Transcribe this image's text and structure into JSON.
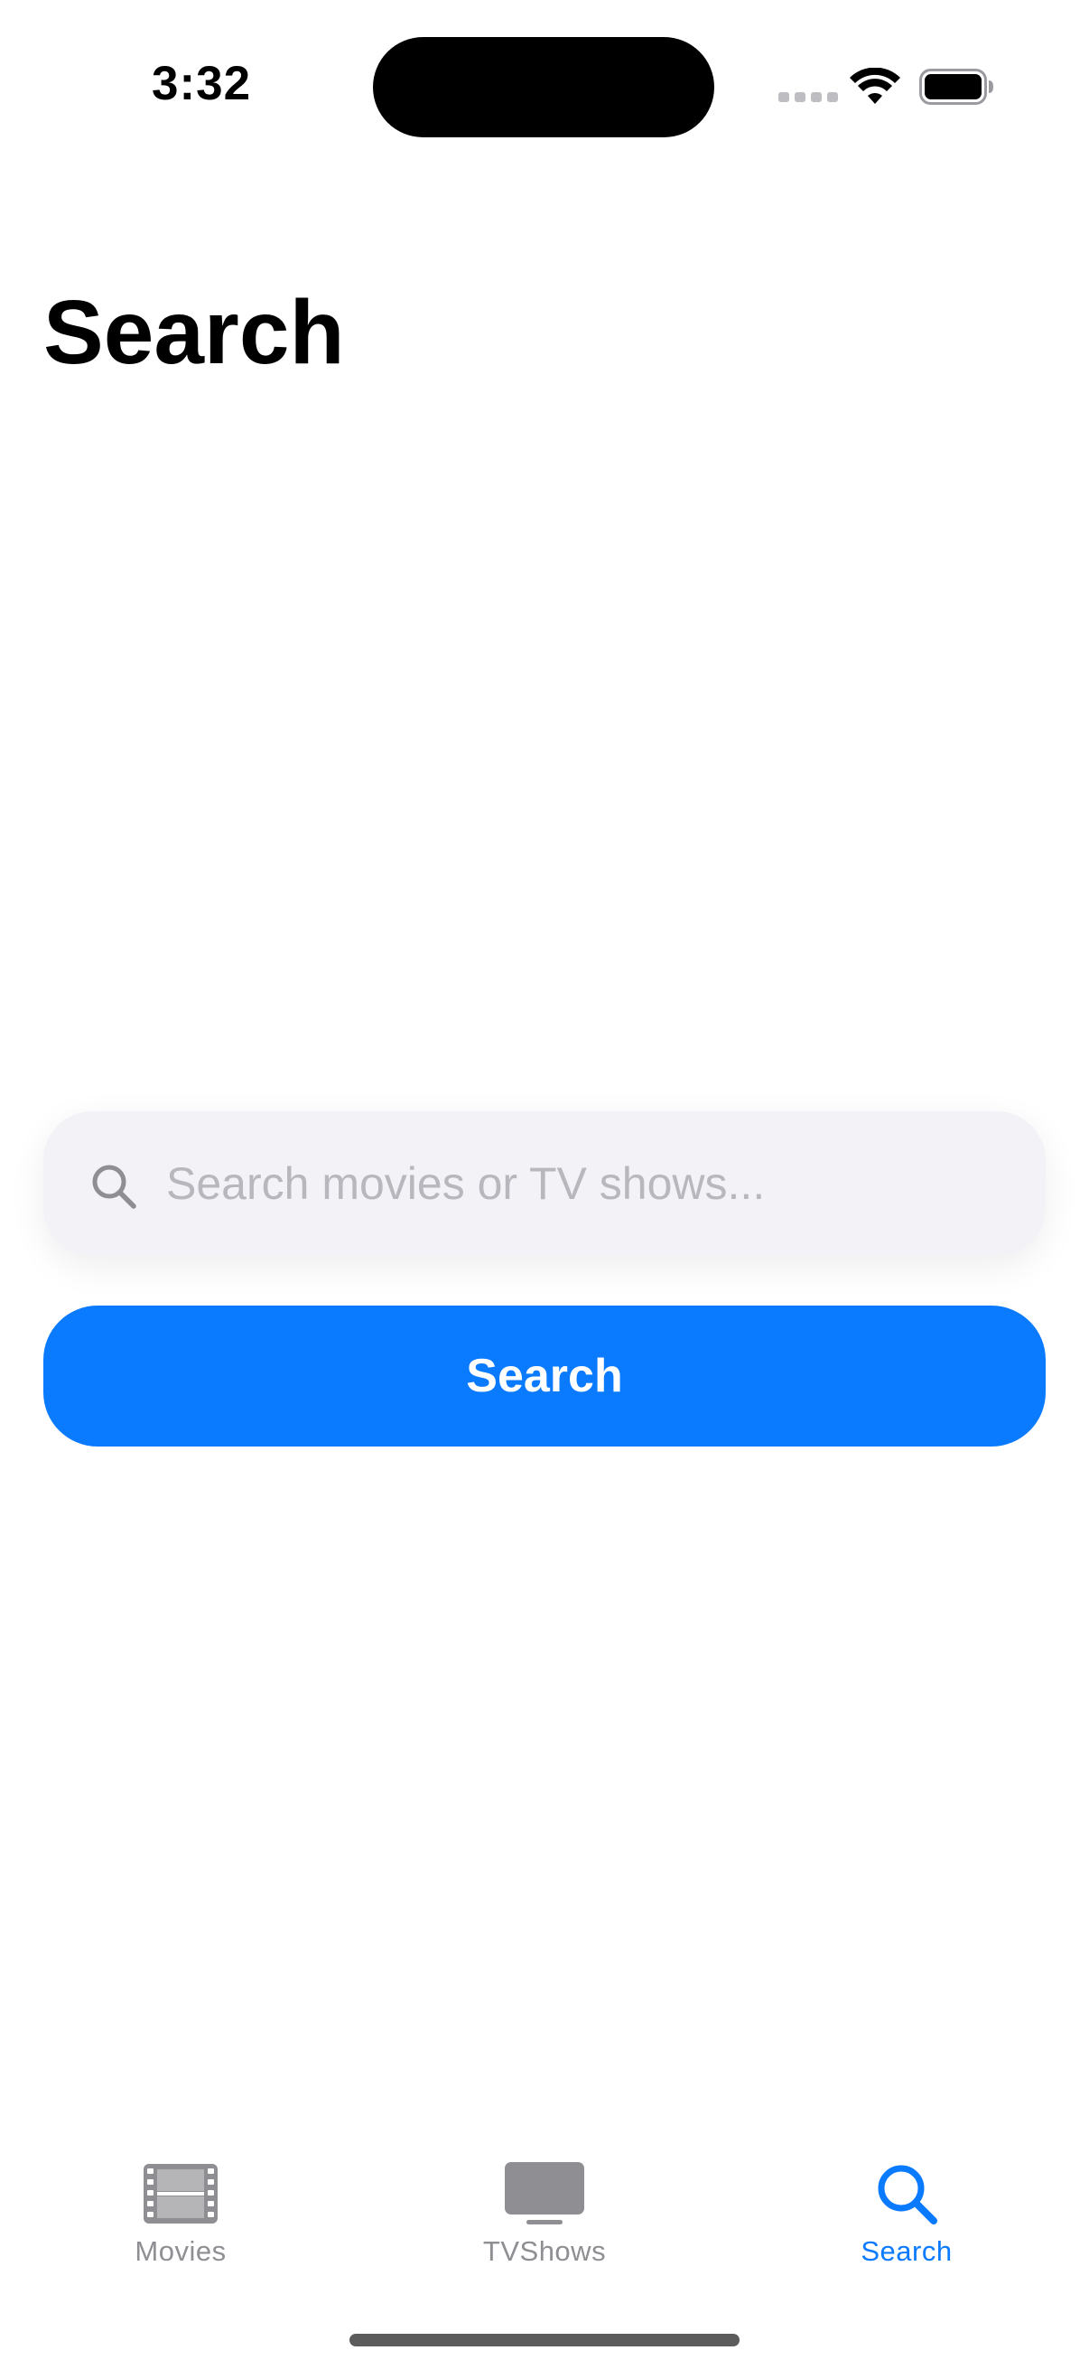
{
  "status_bar": {
    "time": "3:32"
  },
  "header": {
    "title": "Search"
  },
  "search": {
    "value": "",
    "placeholder": "Search movies or TV shows...",
    "button_label": "Search"
  },
  "tab_bar": {
    "active": "search",
    "items": [
      {
        "id": "movies",
        "label": "Movies",
        "icon": "film-icon"
      },
      {
        "id": "tvshows",
        "label": "TVShows",
        "icon": "tv-icon"
      },
      {
        "id": "search",
        "label": "Search",
        "icon": "magnifying-glass-icon"
      }
    ]
  },
  "colors": {
    "accent": "#0a7aff",
    "tab_inactive": "#8e8e93",
    "field_background": "#f2f2f7",
    "placeholder": "#b7b7bd"
  }
}
